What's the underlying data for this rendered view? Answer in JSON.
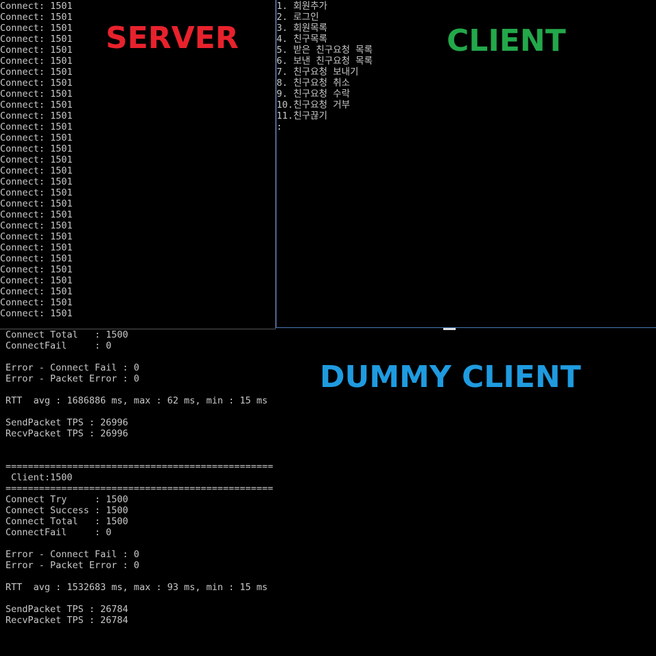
{
  "labels": {
    "server": {
      "text": "SERVER",
      "color": "#e8222c"
    },
    "client": {
      "text": "CLIENT",
      "color": "#23a84a"
    },
    "dummy": {
      "text": "DUMMY CLIENT",
      "color": "#1f9be0"
    }
  },
  "server_console": {
    "lines": [
      "Connect: 1501",
      "Connect: 1501",
      "Connect: 1501",
      "Connect: 1501",
      "Connect: 1501",
      "Connect: 1501",
      "Connect: 1501",
      "Connect: 1501",
      "Connect: 1501",
      "Connect: 1501",
      "Connect: 1501",
      "Connect: 1501",
      "Connect: 1501",
      "Connect: 1501",
      "Connect: 1501",
      "Connect: 1501",
      "Connect: 1501",
      "Connect: 1501",
      "Connect: 1501",
      "Connect: 1501",
      "Connect: 1501",
      "Connect: 1501",
      "Connect: 1501",
      "Connect: 1501",
      "Connect: 1501",
      "Connect: 1501",
      "Connect: 1501",
      "Connect: 1501",
      "Connect: 1501"
    ]
  },
  "client_console": {
    "lines": [
      "1. 회원추가",
      "2. 로그인",
      "3. 회원목록",
      "4. 친구목록",
      "5. 받은 친구요청 목록",
      "6. 보낸 친구요청 목록",
      "7. 친구요청 보내기",
      "8. 친구요청 취소",
      "9. 친구요청 수락",
      "10.친구요청 거부",
      "11.친구끊기",
      ":"
    ]
  },
  "dummy_console": {
    "lines": [
      "Connect Total   : 1500",
      "ConnectFail     : 0",
      "",
      "Error - Connect Fail : 0",
      "Error - Packet Error : 0",
      "",
      "RTT  avg : 1686886 ms, max : 62 ms, min : 15 ms",
      "",
      "SendPacket TPS : 26996",
      "RecvPacket TPS : 26996",
      "",
      "",
      "================================================",
      " Client:1500",
      "================================================",
      "Connect Try     : 1500",
      "Connect Success : 1500",
      "Connect Total   : 1500",
      "ConnectFail     : 0",
      "",
      "Error - Connect Fail : 0",
      "Error - Packet Error : 0",
      "",
      "RTT  avg : 1532683 ms, max : 93 ms, min : 15 ms",
      "",
      "SendPacket TPS : 26784",
      "RecvPacket TPS : 26784"
    ]
  }
}
